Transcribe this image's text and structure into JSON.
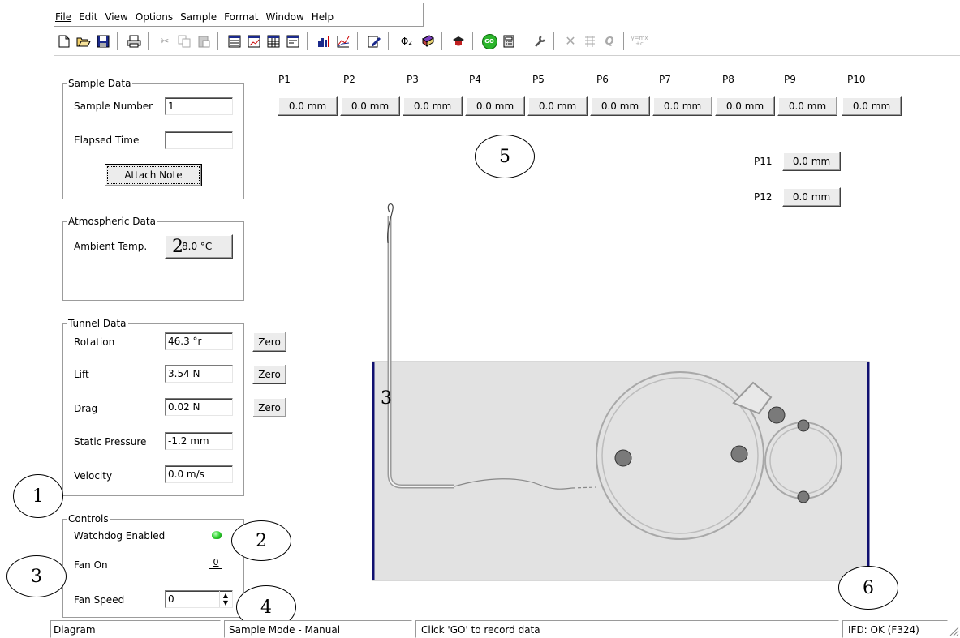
{
  "menu": {
    "file": "File",
    "edit": "Edit",
    "view": "View",
    "options": "Options",
    "sample": "Sample",
    "format": "Format",
    "window": "Window",
    "help": "Help"
  },
  "toolbar_icons": [
    "new-icon",
    "open-icon",
    "save-icon",
    "print-icon",
    "cut-icon",
    "copy-icon",
    "paste-icon",
    "table-view-icon",
    "graph-view-icon",
    "grid-view-icon",
    "data-view-icon",
    "bar-chart-icon",
    "line-chart-icon",
    "edit-note-icon",
    "phi-icon",
    "book-icon",
    "graduation-cap-icon",
    "go-icon",
    "calculator-icon",
    "wrench-icon",
    "delete-icon",
    "grid-disabled-icon",
    "q-icon",
    "formula-icon"
  ],
  "toolbar": {
    "phi_text": "Φ₂",
    "go_text": "GO",
    "q_text": "Q",
    "formula_text": "y=mx +c"
  },
  "sample_data": {
    "legend": "Sample Data",
    "sample_number_label": "Sample Number",
    "sample_number_value": "1",
    "elapsed_time_label": "Elapsed Time",
    "elapsed_time_value": "",
    "attach_note": "Attach Note"
  },
  "atmospheric": {
    "legend": "Atmospheric Data",
    "ambient_label": "Ambient Temp.",
    "ambient_value": "8.0 °C",
    "overlay": "2"
  },
  "tunnel": {
    "legend": "Tunnel Data",
    "rotation_label": "Rotation",
    "rotation_value": "46.3 °r",
    "lift_label": "Lift",
    "lift_value": "3.54 N",
    "drag_label": "Drag",
    "drag_value": "0.02 N",
    "static_label": "Static Pressure",
    "static_value": "-1.2 mm",
    "velocity_label": "Velocity",
    "velocity_value": "0.0 m/s",
    "zero": "Zero"
  },
  "controls": {
    "legend": "Controls",
    "watchdog_label": "Watchdog Enabled",
    "fan_on_label": "Fan On",
    "fan_on_mark": "0",
    "fan_speed_label": "Fan Speed",
    "fan_speed_value": "0"
  },
  "pressures": {
    "labels": [
      "P1",
      "P2",
      "P3",
      "P4",
      "P5",
      "P6",
      "P7",
      "P8",
      "P9",
      "P10"
    ],
    "values": [
      "0.0 mm",
      "0.0 mm",
      "0.0 mm",
      "0.0 mm",
      "0.0 mm",
      "0.0 mm",
      "0.0 mm",
      "0.0 mm",
      "0.0 mm",
      "0.0 mm"
    ],
    "p11_label": "P11",
    "p11_value": "0.0 mm",
    "p12_label": "P12",
    "p12_value": "0.0 mm"
  },
  "diagram": {
    "overlay": "3"
  },
  "callouts": {
    "c1": "1",
    "c2": "2",
    "c3": "3",
    "c4": "4",
    "c5": "5",
    "c6": "6"
  },
  "status": {
    "view": "Diagram",
    "mode": "Sample Mode - Manual",
    "hint": "Click 'GO' to record data",
    "ifd": "IFD: OK (F324)"
  }
}
